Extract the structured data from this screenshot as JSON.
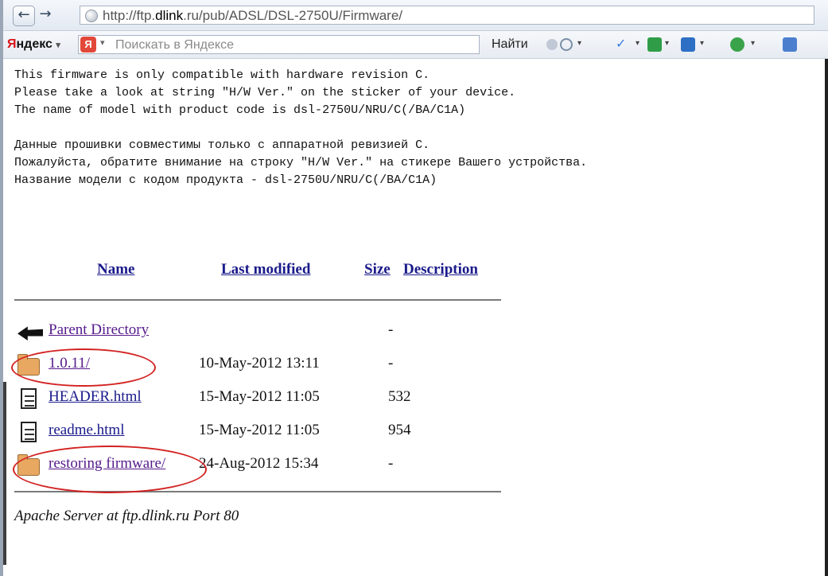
{
  "browser": {
    "url_prefix": "http://ftp.",
    "url_host": "dlink",
    "url_suffix": ".ru/pub/ADSL/DSL-2750U/Firmware/",
    "back_label": "←",
    "forward_label": "→"
  },
  "yandex_toolbar": {
    "brand_first": "Я",
    "brand_rest": "ндекс",
    "brand_arrow": "▾",
    "logo_letter": "Я",
    "search_placeholder": "Поискать в Яндексе",
    "find_label": "Найти"
  },
  "notice": {
    "en_lines": [
      "This firmware is only compatible with hardware revision C.",
      "Please take a look at string \"H/W Ver.\" on the sticker of your device.",
      "The name of model with product code is dsl-2750U/NRU/C(/BA/C1A)"
    ],
    "ru_lines": [
      "Данные прошивки совместимы только с аппаратной ревизией C.",
      "Пожалуйста, обратите внимание на строку \"H/W Ver.\" на стикере Вашего устройства.",
      "Название модели с кодом продукта - dsl-2750U/NRU/C(/BA/C1A)"
    ]
  },
  "listing": {
    "headers": {
      "name": "Name",
      "last_modified": "Last modified",
      "size": "Size",
      "description": "Description"
    },
    "rows": [
      {
        "name": "Parent Directory",
        "date": "",
        "size": "-",
        "icon": "back-icon"
      },
      {
        "name": "1.0.11/",
        "date": "10-May-2012 13:11",
        "size": "-",
        "icon": "folder-icon",
        "highlighted": true
      },
      {
        "name": "HEADER.html",
        "date": "15-May-2012 11:05",
        "size": "532",
        "icon": "document-icon"
      },
      {
        "name": "readme.html",
        "date": "15-May-2012 11:05",
        "size": "954",
        "icon": "document-icon"
      },
      {
        "name": "restoring firmware/",
        "date": "24-Aug-2012 15:34",
        "size": "-",
        "icon": "folder-icon",
        "highlighted": true
      }
    ]
  },
  "footer": {
    "server_signature": "Apache Server at ftp.dlink.ru Port 80"
  },
  "colors": {
    "link": "#1a1a8b",
    "visited_link": "#551a8b",
    "highlight_circle": "#d32222"
  }
}
